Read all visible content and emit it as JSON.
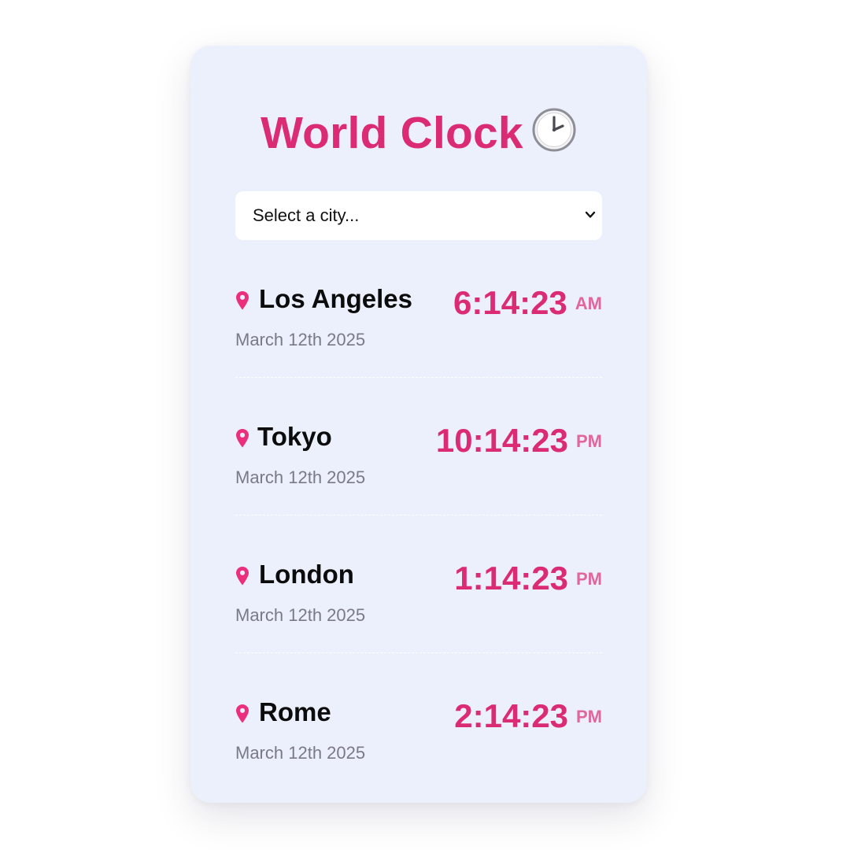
{
  "app": {
    "title": "World Clock",
    "title_icon": "clock-icon"
  },
  "colors": {
    "accent": "#dc2b75",
    "ampm": "#e0669b",
    "card_background": "#ecf0fc",
    "date_text": "#7a7a86"
  },
  "city_select": {
    "selected_value": "Select a city...",
    "icon": "chevron-down-icon"
  },
  "cities": [
    {
      "name": "Los Angeles",
      "date": "March 12th 2025",
      "time": "6:14:23",
      "period": "AM",
      "icon": "map-pin-icon"
    },
    {
      "name": "Tokyo",
      "date": "March 12th 2025",
      "time": "10:14:23",
      "period": "PM",
      "icon": "map-pin-icon"
    },
    {
      "name": "London",
      "date": "March 12th 2025",
      "time": "1:14:23",
      "period": "PM",
      "icon": "map-pin-icon"
    },
    {
      "name": "Rome",
      "date": "March 12th 2025",
      "time": "2:14:23",
      "period": "PM",
      "icon": "map-pin-icon"
    }
  ]
}
